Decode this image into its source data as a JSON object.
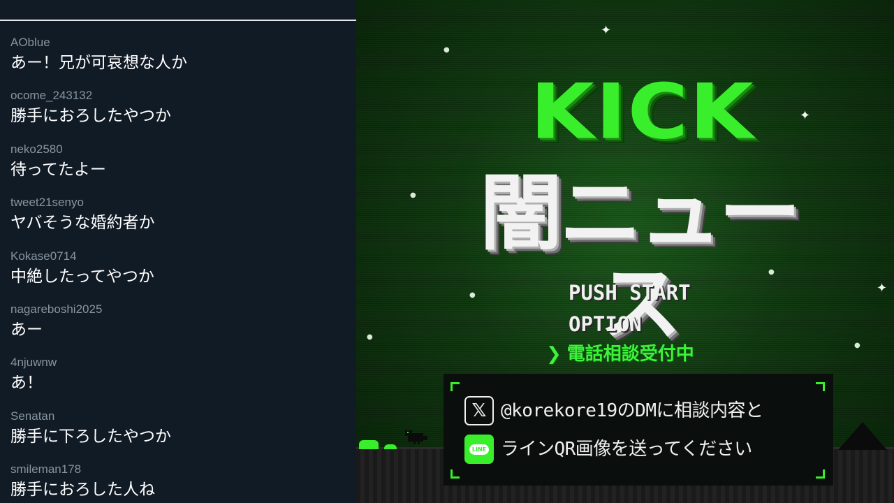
{
  "chat": {
    "messages": [
      {
        "user": "AOblue",
        "text": "あー！兄が可哀想な人か"
      },
      {
        "user": "ocome_243132",
        "text": "勝手におろしたやつか"
      },
      {
        "user": "neko2580",
        "text": "待ってたよー"
      },
      {
        "user": "tweet21senyo",
        "text": "ヤバそうな婚約者か"
      },
      {
        "user": "Kokase0714",
        "text": "中絶したってやつか"
      },
      {
        "user": "nagareboshi2025",
        "text": "あー"
      },
      {
        "user": "4njuwnw",
        "text": "あ！"
      },
      {
        "user": "Senatan",
        "text": "勝手に下ろしたやつか"
      },
      {
        "user": "smileman178",
        "text": "勝手におろした人ね"
      }
    ]
  },
  "stream": {
    "logo_top": "KICK",
    "logo_bottom": "闇ニュース",
    "menu": {
      "start": "PUSH START",
      "option": "OPTION",
      "selected_arrow": "❯",
      "phone": "電話相談受付中"
    },
    "panel": {
      "x_icon_glyph": "𝕏",
      "x_text": "@korekore19のDMに相談内容と",
      "line_icon_glyph": "LINE",
      "line_text": "ラインQR画像を送ってください"
    },
    "colors": {
      "accent_green": "#39ee2a",
      "chat_background": "#111b26"
    }
  }
}
